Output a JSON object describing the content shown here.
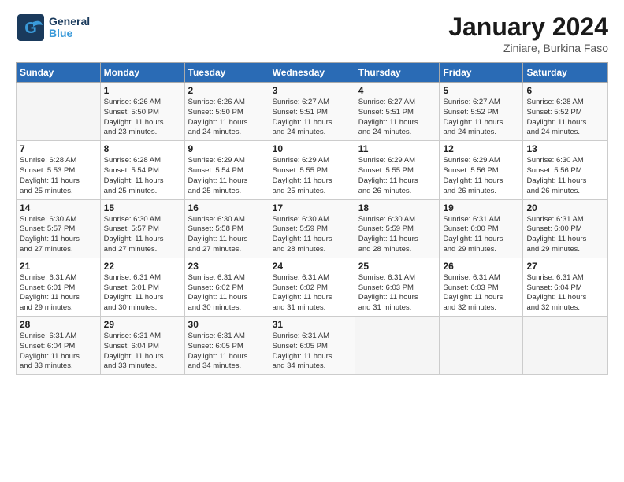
{
  "logo": {
    "general": "General",
    "blue": "Blue"
  },
  "header": {
    "title": "January 2024",
    "subtitle": "Ziniare, Burkina Faso"
  },
  "days_of_week": [
    "Sunday",
    "Monday",
    "Tuesday",
    "Wednesday",
    "Thursday",
    "Friday",
    "Saturday"
  ],
  "weeks": [
    [
      {
        "day": "",
        "info": ""
      },
      {
        "day": "1",
        "info": "Sunrise: 6:26 AM\nSunset: 5:50 PM\nDaylight: 11 hours\nand 23 minutes."
      },
      {
        "day": "2",
        "info": "Sunrise: 6:26 AM\nSunset: 5:50 PM\nDaylight: 11 hours\nand 24 minutes."
      },
      {
        "day": "3",
        "info": "Sunrise: 6:27 AM\nSunset: 5:51 PM\nDaylight: 11 hours\nand 24 minutes."
      },
      {
        "day": "4",
        "info": "Sunrise: 6:27 AM\nSunset: 5:51 PM\nDaylight: 11 hours\nand 24 minutes."
      },
      {
        "day": "5",
        "info": "Sunrise: 6:27 AM\nSunset: 5:52 PM\nDaylight: 11 hours\nand 24 minutes."
      },
      {
        "day": "6",
        "info": "Sunrise: 6:28 AM\nSunset: 5:52 PM\nDaylight: 11 hours\nand 24 minutes."
      }
    ],
    [
      {
        "day": "7",
        "info": "Sunrise: 6:28 AM\nSunset: 5:53 PM\nDaylight: 11 hours\nand 25 minutes."
      },
      {
        "day": "8",
        "info": "Sunrise: 6:28 AM\nSunset: 5:54 PM\nDaylight: 11 hours\nand 25 minutes."
      },
      {
        "day": "9",
        "info": "Sunrise: 6:29 AM\nSunset: 5:54 PM\nDaylight: 11 hours\nand 25 minutes."
      },
      {
        "day": "10",
        "info": "Sunrise: 6:29 AM\nSunset: 5:55 PM\nDaylight: 11 hours\nand 25 minutes."
      },
      {
        "day": "11",
        "info": "Sunrise: 6:29 AM\nSunset: 5:55 PM\nDaylight: 11 hours\nand 26 minutes."
      },
      {
        "day": "12",
        "info": "Sunrise: 6:29 AM\nSunset: 5:56 PM\nDaylight: 11 hours\nand 26 minutes."
      },
      {
        "day": "13",
        "info": "Sunrise: 6:30 AM\nSunset: 5:56 PM\nDaylight: 11 hours\nand 26 minutes."
      }
    ],
    [
      {
        "day": "14",
        "info": "Sunrise: 6:30 AM\nSunset: 5:57 PM\nDaylight: 11 hours\nand 27 minutes."
      },
      {
        "day": "15",
        "info": "Sunrise: 6:30 AM\nSunset: 5:57 PM\nDaylight: 11 hours\nand 27 minutes."
      },
      {
        "day": "16",
        "info": "Sunrise: 6:30 AM\nSunset: 5:58 PM\nDaylight: 11 hours\nand 27 minutes."
      },
      {
        "day": "17",
        "info": "Sunrise: 6:30 AM\nSunset: 5:59 PM\nDaylight: 11 hours\nand 28 minutes."
      },
      {
        "day": "18",
        "info": "Sunrise: 6:30 AM\nSunset: 5:59 PM\nDaylight: 11 hours\nand 28 minutes."
      },
      {
        "day": "19",
        "info": "Sunrise: 6:31 AM\nSunset: 6:00 PM\nDaylight: 11 hours\nand 29 minutes."
      },
      {
        "day": "20",
        "info": "Sunrise: 6:31 AM\nSunset: 6:00 PM\nDaylight: 11 hours\nand 29 minutes."
      }
    ],
    [
      {
        "day": "21",
        "info": "Sunrise: 6:31 AM\nSunset: 6:01 PM\nDaylight: 11 hours\nand 29 minutes."
      },
      {
        "day": "22",
        "info": "Sunrise: 6:31 AM\nSunset: 6:01 PM\nDaylight: 11 hours\nand 30 minutes."
      },
      {
        "day": "23",
        "info": "Sunrise: 6:31 AM\nSunset: 6:02 PM\nDaylight: 11 hours\nand 30 minutes."
      },
      {
        "day": "24",
        "info": "Sunrise: 6:31 AM\nSunset: 6:02 PM\nDaylight: 11 hours\nand 31 minutes."
      },
      {
        "day": "25",
        "info": "Sunrise: 6:31 AM\nSunset: 6:03 PM\nDaylight: 11 hours\nand 31 minutes."
      },
      {
        "day": "26",
        "info": "Sunrise: 6:31 AM\nSunset: 6:03 PM\nDaylight: 11 hours\nand 32 minutes."
      },
      {
        "day": "27",
        "info": "Sunrise: 6:31 AM\nSunset: 6:04 PM\nDaylight: 11 hours\nand 32 minutes."
      }
    ],
    [
      {
        "day": "28",
        "info": "Sunrise: 6:31 AM\nSunset: 6:04 PM\nDaylight: 11 hours\nand 33 minutes."
      },
      {
        "day": "29",
        "info": "Sunrise: 6:31 AM\nSunset: 6:04 PM\nDaylight: 11 hours\nand 33 minutes."
      },
      {
        "day": "30",
        "info": "Sunrise: 6:31 AM\nSunset: 6:05 PM\nDaylight: 11 hours\nand 34 minutes."
      },
      {
        "day": "31",
        "info": "Sunrise: 6:31 AM\nSunset: 6:05 PM\nDaylight: 11 hours\nand 34 minutes."
      },
      {
        "day": "",
        "info": ""
      },
      {
        "day": "",
        "info": ""
      },
      {
        "day": "",
        "info": ""
      }
    ]
  ]
}
